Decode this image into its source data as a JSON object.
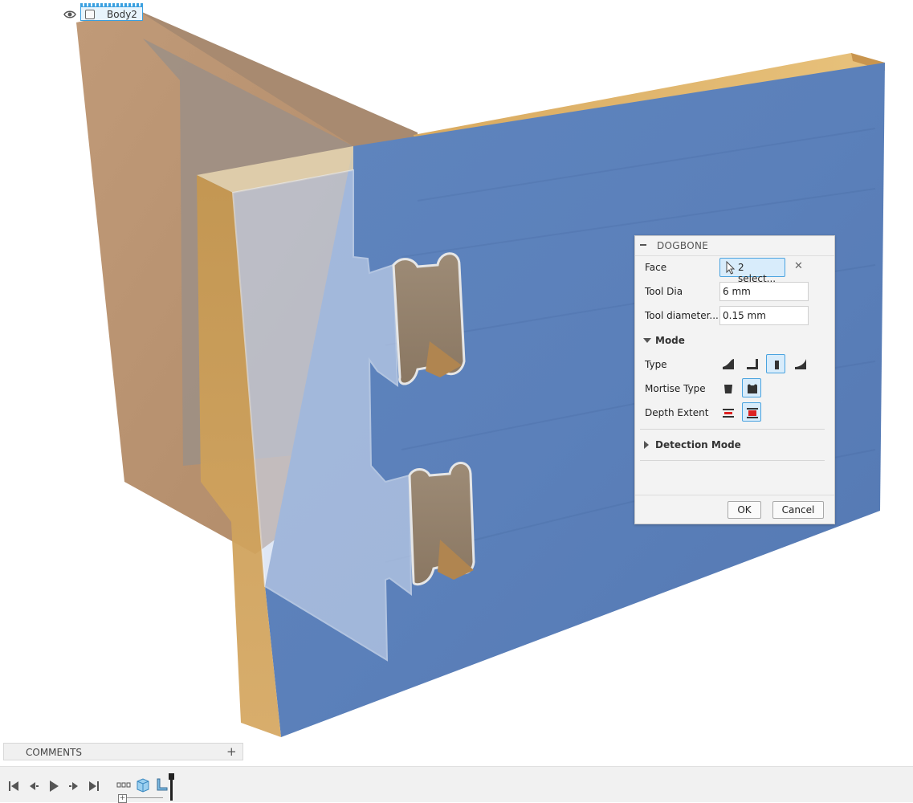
{
  "browser": {
    "body_name": "Body2",
    "visible_icon": "eye-icon"
  },
  "dialog": {
    "title": "DOGBONE",
    "face_label": "Face",
    "face_selection": "2 select...",
    "tool_dia_label": "Tool Dia",
    "tool_dia_value": "6 mm",
    "tool_offset_label": "Tool diameter...",
    "tool_offset_value": "0.15 mm",
    "mode_section": "Mode",
    "type_label": "Type",
    "type_options": [
      "dogbone-corner",
      "normal-corner",
      "minimal-dogbone",
      "radius-corner"
    ],
    "type_selected_index": 2,
    "mortise_label": "Mortise Type",
    "mortise_options": [
      "mortise-on-long-side",
      "mortise-on-short-side"
    ],
    "mortise_selected_index": 1,
    "depth_label": "Depth Extent",
    "depth_options": [
      "from-top-face",
      "full-depth"
    ],
    "depth_selected_index": 1,
    "detection_section": "Detection Mode",
    "ok_label": "OK",
    "cancel_label": "Cancel",
    "accent_color": "#4aa3df"
  },
  "comments": {
    "label": "COMMENTS",
    "add_icon": "+"
  },
  "timeline": {
    "controls": [
      "first-icon",
      "previous-icon",
      "play-icon",
      "next-icon",
      "last-icon"
    ]
  }
}
